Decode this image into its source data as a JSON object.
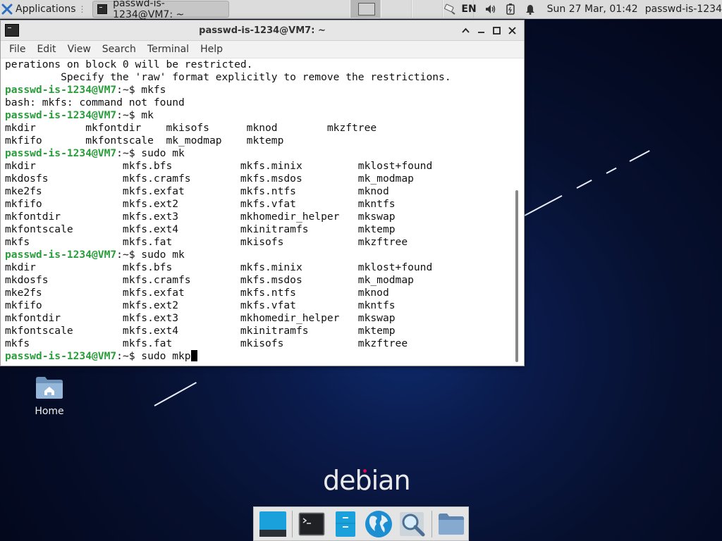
{
  "panel": {
    "apps_label": "Applications",
    "task_label": "passwd-is-1234@VM7: ~",
    "lang": "EN",
    "clock": "Sun 27 Mar, 01:42",
    "user": "passwd-is-1234"
  },
  "window": {
    "title": "passwd-is-1234@VM7: ~",
    "menu": [
      "File",
      "Edit",
      "View",
      "Search",
      "Terminal",
      "Help"
    ]
  },
  "terminal": {
    "prompt": "passwd-is-1234@VM7",
    "lines": [
      {
        "text": "perations on block 0 will be restricted."
      },
      {
        "text": "         Specify the 'raw' format explicitly to remove the restrictions."
      },
      {
        "path": ":~$",
        "cmd": " mkfs"
      },
      {
        "text": "bash: mkfs: command not found"
      },
      {
        "path": ":~$",
        "cmd": " mk"
      },
      {
        "text": "mkdir        mkfontdir    mkisofs      mknod        mkzftree"
      },
      {
        "text": "mkfifo       mkfontscale  mk_modmap    mktemp"
      },
      {
        "path": ":~$",
        "cmd": " sudo mk"
      },
      {
        "text": "mkdir              mkfs.bfs           mkfs.minix         mklost+found"
      },
      {
        "text": "mkdosfs            mkfs.cramfs        mkfs.msdos         mk_modmap"
      },
      {
        "text": "mke2fs             mkfs.exfat         mkfs.ntfs          mknod"
      },
      {
        "text": "mkfifo             mkfs.ext2          mkfs.vfat          mkntfs"
      },
      {
        "text": "mkfontdir          mkfs.ext3          mkhomedir_helper   mkswap"
      },
      {
        "text": "mkfontscale        mkfs.ext4          mkinitramfs        mktemp"
      },
      {
        "text": "mkfs               mkfs.fat           mkisofs            mkzftree"
      },
      {
        "path": ":~$",
        "cmd": " sudo mk"
      },
      {
        "text": "mkdir              mkfs.bfs           mkfs.minix         mklost+found"
      },
      {
        "text": "mkdosfs            mkfs.cramfs        mkfs.msdos         mk_modmap"
      },
      {
        "text": "mke2fs             mkfs.exfat         mkfs.ntfs          mknod"
      },
      {
        "text": "mkfifo             mkfs.ext2          mkfs.vfat          mkntfs"
      },
      {
        "text": "mkfontdir          mkfs.ext3          mkhomedir_helper   mkswap"
      },
      {
        "text": "mkfontscale        mkfs.ext4          mkinitramfs        mktemp"
      },
      {
        "text": "mkfs               mkfs.fat           mkisofs            mkzftree"
      },
      {
        "path": ":~$",
        "cmd": " sudo mkp",
        "cursor": true
      }
    ]
  },
  "desktop": {
    "home_label": "Home",
    "logo_text": "debian"
  },
  "dock": {
    "items": [
      "show-desktop",
      "terminal",
      "file-manager",
      "web-browser",
      "app-finder",
      "home-folder"
    ]
  },
  "colors": {
    "prompt": "#2a9d3b",
    "logo_dot": "#d70a53",
    "desktop_bg": "#06102e"
  }
}
